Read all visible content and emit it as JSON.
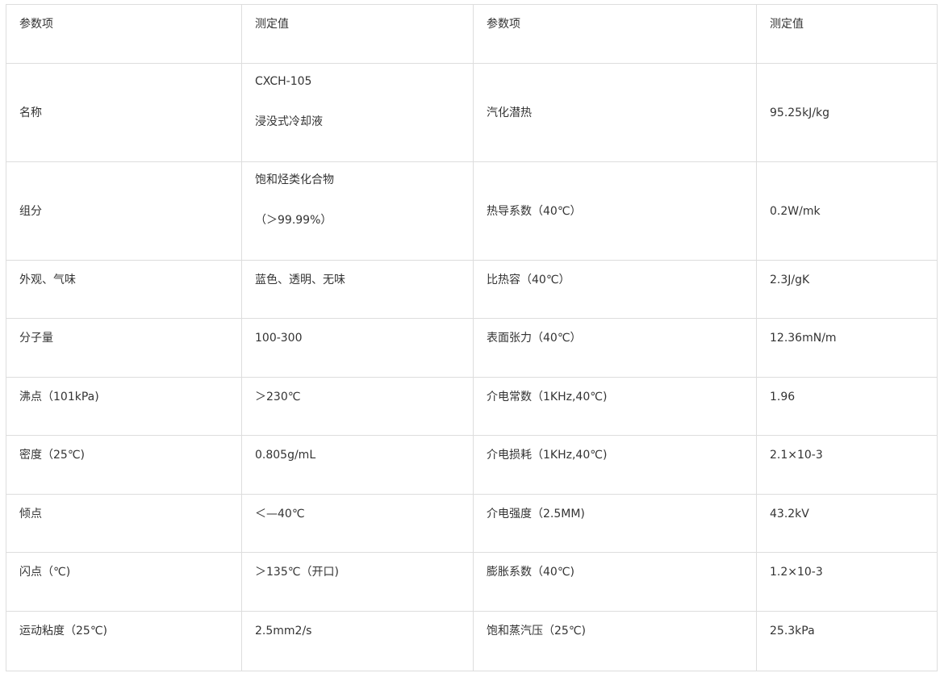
{
  "table": {
    "header": {
      "col1": "参数项",
      "col2": "测定值",
      "col3": "参数项",
      "col4": "测定值"
    },
    "rows": [
      {
        "param1": "名称",
        "value1_line1": "CXCH-105",
        "value1_line2": "浸没式冷却液",
        "param2": "汽化潜热",
        "value2": "95.25kJ/kg"
      },
      {
        "param1": "组分",
        "value1_line1": "饱和烃类化合物",
        "value1_line2": "（＞99.99%）",
        "param2": "热导系数（40℃）",
        "value2": "0.2W/mk"
      },
      {
        "param1": "外观、气味",
        "value1": "蓝色、透明、无味",
        "param2": "比热容（40℃）",
        "value2": "2.3J/gK"
      },
      {
        "param1": "分子量",
        "value1": "100-300",
        "param2": "表面张力（40℃）",
        "value2": "12.36mN/m"
      },
      {
        "param1": "沸点（101kPa)",
        "value1": "＞230℃",
        "param2": "介电常数（1KHz,40℃)",
        "value2": "1.96"
      },
      {
        "param1": "密度（25℃)",
        "value1": "0.805g/mL",
        "param2": "介电损耗（1KHz,40℃)",
        "value2": "2.1×10-3"
      },
      {
        "param1": "倾点",
        "value1": "＜—40℃",
        "param2": "介电强度（2.5MM)",
        "value2": "43.2kV"
      },
      {
        "param1": "闪点（℃)",
        "value1": "＞135℃（开口)",
        "param2": "膨胀系数（40℃)",
        "value2": "1.2×10-3"
      },
      {
        "param1": "运动粘度（25℃)",
        "value1": "2.5mm2/s",
        "param2": "饱和蒸汽压（25℃)",
        "value2": "25.3kPa"
      }
    ]
  }
}
